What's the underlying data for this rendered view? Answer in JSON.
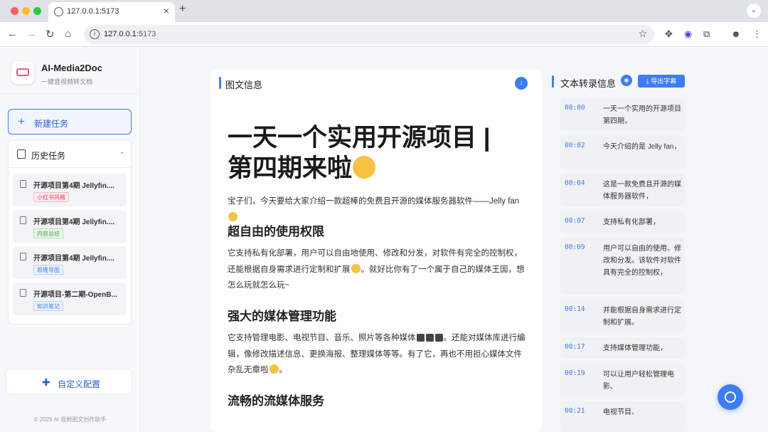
{
  "browser": {
    "tab_title": "127.0.0.1:5173",
    "url_host": "127.0.0.1",
    "url_port": ":5173",
    "new_tab": "+",
    "close_tab": "×"
  },
  "sidebar": {
    "app_name": "AI-Media2Doc",
    "app_subtitle": "一键音视频转文档",
    "new_task_label": "新建任务",
    "history_label": "历史任务",
    "history_items": [
      {
        "title": "开源项目第4期 Jellyfin....",
        "tag": "小红书风格",
        "tag_color": "#e6405c"
      },
      {
        "title": "开源项目第4期 Jellyfin....",
        "tag": "内容总结",
        "tag_color": "#3aa54a"
      },
      {
        "title": "开源项目第4期 Jellyfin....",
        "tag": "思维导图",
        "tag_color": "#3d7df0"
      },
      {
        "title": "开源项目-第二期-OpenB...",
        "tag": "知识笔记",
        "tag_color": "#3d7df0"
      }
    ],
    "custom_config_label": "自定义配置",
    "footer": "© 2025 AI 视频图文创作助手"
  },
  "article": {
    "section_title": "图文信息",
    "title": "一天一个实用开源项目 | 第四期来啦",
    "intro": "宝子们，今天要给大家介绍一款超棒的免费且开源的媒体服务器软件——Jelly fan",
    "h2_1": "超自由的使用权限",
    "p1": "它支持私有化部署，用户可以自由地使用、修改和分发，对软件有完全的控制权，还能根据自身需求进行定制和扩展",
    "p1_tail": "。就好比你有了一个属于自己的媒体王国，想怎么玩就怎么玩~",
    "h2_2": "强大的媒体管理功能",
    "p2": "它支持管理电影、电视节目、音乐、照片等各种媒体",
    "p2_tail": "。还能对媒体库进行编辑，像修改描述信息、更换海报、整理媒体等等。有了它，再也不用担心媒体文件杂乱无章啦",
    "p2_end": "。",
    "h2_3": "流畅的流媒体服务"
  },
  "transcript": {
    "section_title": "文本转录信息",
    "export_label": "导出字幕",
    "lines": [
      {
        "time": "00:00",
        "text": "一天一个实用的开源项目第四期，"
      },
      {
        "time": "00:02",
        "text": "今天介绍的是 Jelly fan，"
      },
      {
        "time": "00:04",
        "text": "这是一款免费且开源的媒体服务器软件，"
      },
      {
        "time": "00:07",
        "text": "支持私有化部署，"
      },
      {
        "time": "00:09",
        "text": "用户可以自由的使用、修改和分发。该软件对软件具有完全的控制权，"
      },
      {
        "time": "00:14",
        "text": "并能根据自身需求进行定制和扩展。"
      },
      {
        "time": "00:17",
        "text": "支持媒体管理功能，"
      },
      {
        "time": "00:19",
        "text": "可以让用户轻松管理电影、"
      },
      {
        "time": "00:21",
        "text": "电视节目、"
      }
    ]
  }
}
